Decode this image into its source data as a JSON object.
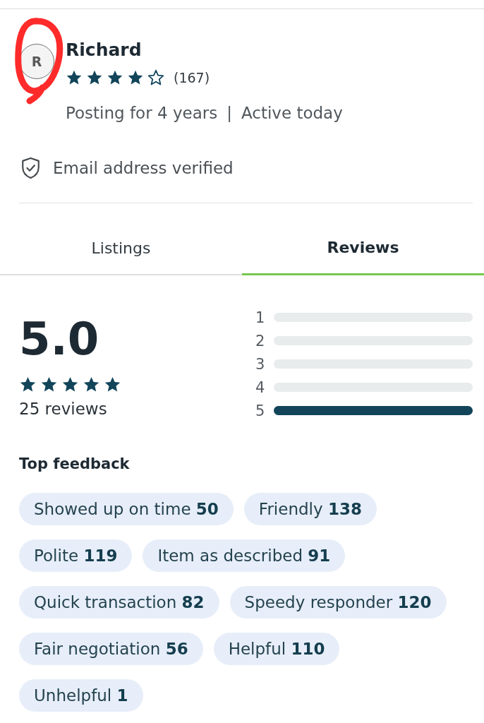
{
  "profile": {
    "avatar_initial": "R",
    "annotation": {
      "kind": "freehand-circle"
    },
    "name": "Richard",
    "stars": 4,
    "rating_count": "(167)",
    "posting_for": "Posting for 4 years",
    "separator": "|",
    "activity": "Active today",
    "verification": "Email address verified"
  },
  "tabs": [
    {
      "label": "Listings",
      "selected": false
    },
    {
      "label": "Reviews",
      "selected": true
    }
  ],
  "rating_summary": {
    "score": "5.0",
    "stars": 5,
    "review_count": "25 reviews",
    "distribution": [
      {
        "label": "1",
        "level": 0
      },
      {
        "label": "2",
        "level": 0
      },
      {
        "label": "3",
        "level": 0
      },
      {
        "label": "4",
        "level": 0
      },
      {
        "label": "5",
        "level": 1
      }
    ]
  },
  "top_feedback": {
    "title": "Top feedback",
    "tags": [
      {
        "text": "Showed up on time **50**"
      },
      {
        "text": "Friendly **138**"
      },
      {
        "text": "Polite **119**"
      },
      {
        "text": "Item as described **91**"
      },
      {
        "text": "Quick transaction **82**"
      },
      {
        "text": "Speedy responder **120**"
      },
      {
        "text": "Fair negotiation **56**"
      },
      {
        "text": "Helpful **110**"
      },
      {
        "text": "Unhelpful **1**"
      }
    ]
  }
}
